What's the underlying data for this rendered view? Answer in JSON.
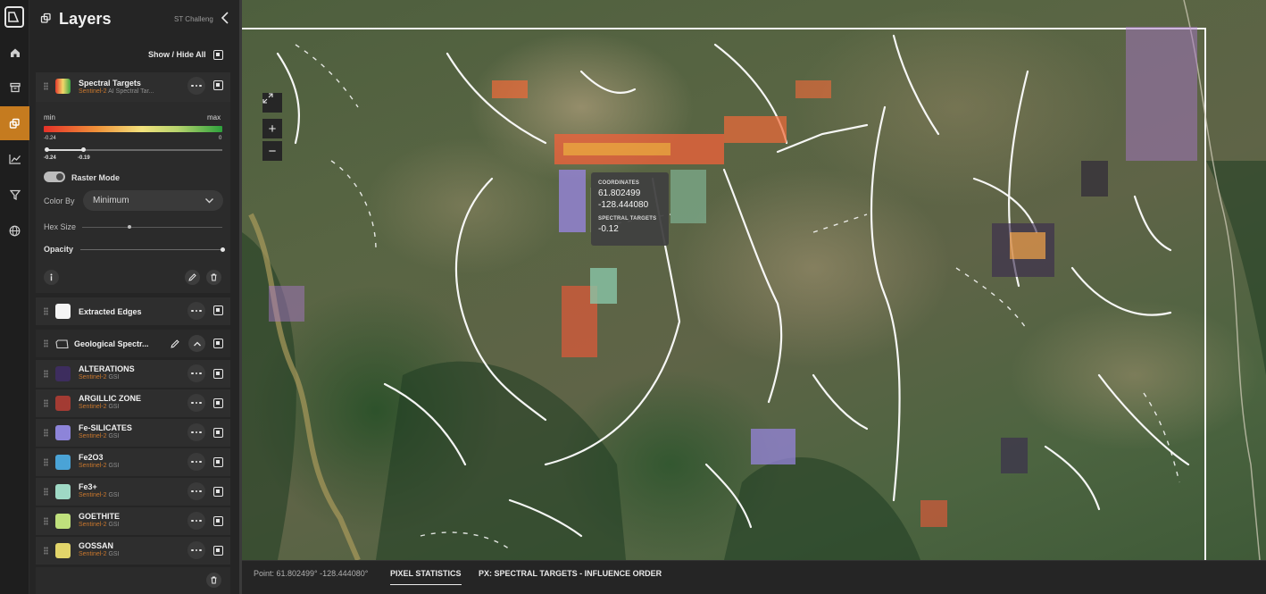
{
  "panel": {
    "title": "Layers",
    "project": "ST Challeng",
    "show_hide_all": "Show / Hide All"
  },
  "spectral": {
    "name": "Spectral Targets",
    "source": "Sentinel-2",
    "detail": "AI Spectral Tar...",
    "legend_min": "min",
    "legend_max": "max",
    "range_low": "-0.24",
    "range_high": "0",
    "slider_low": "-0.24",
    "slider_high": "-0.19",
    "raster_mode": "Raster Mode",
    "color_by_label": "Color By",
    "color_by_value": "Minimum",
    "hex_size": "Hex Size",
    "opacity": "Opacity",
    "opacity_level": 1.0
  },
  "edges": {
    "name": "Extracted Edges"
  },
  "group": {
    "name": "Geological Spectr..."
  },
  "layers": [
    {
      "name": "ALTERATIONS",
      "source": "Sentinel-2",
      "tag": "GSI",
      "color": "#3d2d5e"
    },
    {
      "name": "ARGILLIC ZONE",
      "source": "Sentinel-2",
      "tag": "GSI",
      "color": "#a33b33"
    },
    {
      "name": "Fe-SILICATES",
      "source": "Sentinel-2",
      "tag": "GSI",
      "color": "#8d84d9"
    },
    {
      "name": "Fe2O3",
      "source": "Sentinel-2",
      "tag": "GSI",
      "color": "#4aa3d6"
    },
    {
      "name": "Fe3+",
      "source": "Sentinel-2",
      "tag": "GSI",
      "color": "#9fd9c5"
    },
    {
      "name": "GOETHITE",
      "source": "Sentinel-2",
      "tag": "GSI",
      "color": "#bfe07c"
    },
    {
      "name": "GOSSAN",
      "source": "Sentinel-2",
      "tag": "GSI",
      "color": "#e2d56a"
    }
  ],
  "tooltip": {
    "coord_label": "COORDINATES",
    "lat": "61.802499",
    "lon": "-128.444080",
    "value_label": "SPECTRAL TARGETS",
    "value": "-0.12"
  },
  "bottom": {
    "point": "Point: 61.802499° -128.444080°",
    "tab_pixel": "PIXEL STATISTICS",
    "tab_px": "PX: SPECTRAL TARGETS - INFLUENCE ORDER"
  },
  "map_controls": {
    "zoom_in": "+",
    "zoom_out": "−"
  },
  "colors": {
    "accent": "#c57b1f",
    "subtitle": "#c9772d"
  },
  "icons": [
    "logo-icon",
    "home-icon",
    "archive-icon",
    "layers-icon",
    "chart-icon",
    "filter-icon",
    "globe-icon"
  ]
}
